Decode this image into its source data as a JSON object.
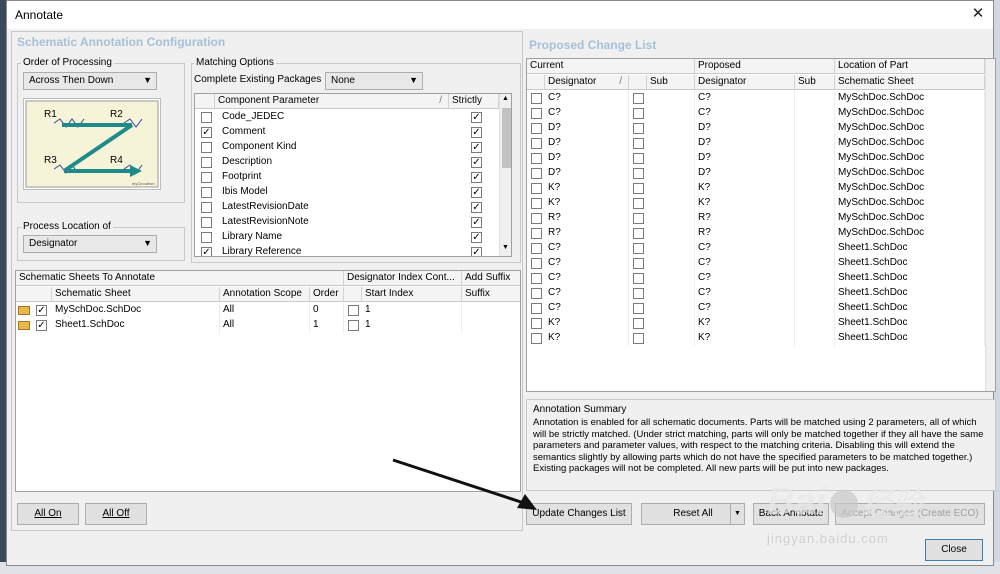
{
  "window": {
    "title": "Annotate",
    "close_glyph": "✕"
  },
  "left": {
    "section_title": "Schematic Annotation Configuration",
    "order": {
      "label": "Order of Processing",
      "value": "Across Then Down"
    },
    "diagram": {
      "r1": "R1",
      "r2": "R2",
      "r3": "R3",
      "r4": "R4",
      "logo": "myCircuitron"
    },
    "matching": {
      "label": "Matching Options",
      "packages_label": "Complete Existing Packages",
      "packages_value": "None",
      "header_param": "Component Parameter",
      "header_strict": "Strictly",
      "params": [
        {
          "name": "Code_JEDEC",
          "checked": false,
          "strict": true
        },
        {
          "name": "Comment",
          "checked": true,
          "strict": true
        },
        {
          "name": "Component Kind",
          "checked": false,
          "strict": true
        },
        {
          "name": "Description",
          "checked": false,
          "strict": true
        },
        {
          "name": "Footprint",
          "checked": false,
          "strict": true
        },
        {
          "name": "Ibis Model",
          "checked": false,
          "strict": true
        },
        {
          "name": "LatestRevisionDate",
          "checked": false,
          "strict": true
        },
        {
          "name": "LatestRevisionNote",
          "checked": false,
          "strict": true
        },
        {
          "name": "Library Name",
          "checked": false,
          "strict": true
        },
        {
          "name": "Library Reference",
          "checked": true,
          "strict": true
        }
      ]
    },
    "location": {
      "label": "Process Location of",
      "value": "Designator"
    },
    "sheets": {
      "header_group1": "Schematic Sheets To Annotate",
      "header_group2": "Designator Index Cont...",
      "header_group3": "Add Suffix",
      "col_sheet": "Schematic Sheet",
      "col_scope": "Annotation Scope",
      "col_order": "Order",
      "col_start": "Start Index",
      "col_suffix": "Suffix",
      "rows": [
        {
          "sheet": "MySchDoc.SchDoc",
          "scope": "All",
          "order": "0",
          "start": "1"
        },
        {
          "sheet": "Sheet1.SchDoc",
          "scope": "All",
          "order": "1",
          "start": "1"
        }
      ]
    },
    "buttons": {
      "all_on": "All On",
      "all_off": "All Off"
    }
  },
  "right": {
    "section_title": "Proposed Change List",
    "group_current": "Current",
    "group_proposed": "Proposed",
    "group_location": "Location of Part",
    "col_designator": "Designator",
    "col_sub": "Sub",
    "col_designator2": "Designator",
    "col_sub2": "Sub",
    "col_sheet": "Schematic Sheet",
    "rows": [
      {
        "cur": "C?",
        "prop": "C?",
        "loc": "MySchDoc.SchDoc"
      },
      {
        "cur": "C?",
        "prop": "C?",
        "loc": "MySchDoc.SchDoc"
      },
      {
        "cur": "D?",
        "prop": "D?",
        "loc": "MySchDoc.SchDoc"
      },
      {
        "cur": "D?",
        "prop": "D?",
        "loc": "MySchDoc.SchDoc"
      },
      {
        "cur": "D?",
        "prop": "D?",
        "loc": "MySchDoc.SchDoc"
      },
      {
        "cur": "D?",
        "prop": "D?",
        "loc": "MySchDoc.SchDoc"
      },
      {
        "cur": "K?",
        "prop": "K?",
        "loc": "MySchDoc.SchDoc"
      },
      {
        "cur": "K?",
        "prop": "K?",
        "loc": "MySchDoc.SchDoc"
      },
      {
        "cur": "R?",
        "prop": "R?",
        "loc": "MySchDoc.SchDoc"
      },
      {
        "cur": "R?",
        "prop": "R?",
        "loc": "MySchDoc.SchDoc"
      },
      {
        "cur": "C?",
        "prop": "C?",
        "loc": "Sheet1.SchDoc"
      },
      {
        "cur": "C?",
        "prop": "C?",
        "loc": "Sheet1.SchDoc"
      },
      {
        "cur": "C?",
        "prop": "C?",
        "loc": "Sheet1.SchDoc"
      },
      {
        "cur": "C?",
        "prop": "C?",
        "loc": "Sheet1.SchDoc"
      },
      {
        "cur": "C?",
        "prop": "C?",
        "loc": "Sheet1.SchDoc"
      },
      {
        "cur": "K?",
        "prop": "K?",
        "loc": "Sheet1.SchDoc"
      },
      {
        "cur": "K?",
        "prop": "K?",
        "loc": "Sheet1.SchDoc"
      }
    ],
    "summary": {
      "title": "Annotation Summary",
      "text": "Annotation is enabled for all schematic documents. Parts will be matched using 2 parameters, all of which will be strictly matched. (Under strict matching, parts will only be matched together if they all have the same parameters and parameter values, with respect to the matching criteria. Disabling this will extend the semantics slightly by allowing parts which do not have the specified parameters to be matched together.) Existing packages will not be completed. All new parts will be put into new packages."
    },
    "buttons": {
      "update": "Update Changes List",
      "reset": "Reset All",
      "back": "Back Annotate",
      "accept": "Accept Changes (Create ECO)",
      "close": "Close"
    }
  },
  "watermark": {
    "brand": "Bai",
    "brand2": "经验",
    "url": "jingyan.baidu.com"
  }
}
